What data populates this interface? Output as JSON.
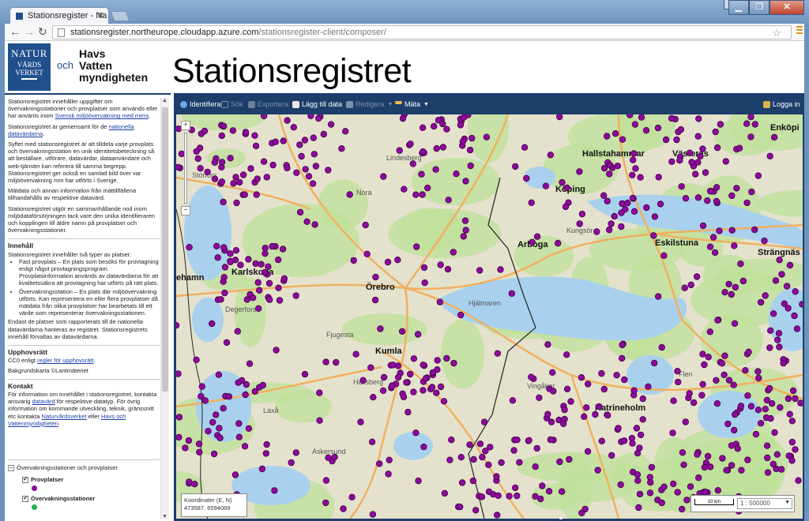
{
  "browser": {
    "tab_title": "Stationsregister - Na",
    "url_host": "stationsregister.northeurope.cloudapp.azure.com",
    "url_path": "/stationsregister-client/composer/"
  },
  "header": {
    "logo_line1": "NATUR",
    "logo_line2": "VÅRDS",
    "logo_line3": "VERKET",
    "och": "och",
    "hav_line1": "Havs",
    "hav_line2": "Vatten",
    "hav_line3": "myndigheten",
    "title": "Stationsregistret"
  },
  "sidebar": {
    "p1": "Stationsregistret innehåller uppgifter om övervakningsstationer och provplatser som används eller har använts inom",
    "p1_link": "Svensk miljöövervakning med mera",
    "p2": "Stationsregistret är gemensamt för de",
    "p2_link": "nationella datavärdarna",
    "p3": "Syftet med stationsregistret är att tilldela varje provplats och övervakningsstation en unik identitetsbeteckning så att beställare, utförare, datavärdar, dataanvändare och web-tjänster kan referera till samma begrepp. Stationsregistret ger också en samlad bild över var miljöövervakning mm har utförts i Sverige.",
    "p4": "Mätdata och annan information från mättillfällena tillhandahålls av respektive datavärd.",
    "p5": "Stationsregistret utgör en sammanhållande nod inom miljödataförsörjningen tack vare den unika identifieraren och kopplingen till äldre namn på provplatser och övervakningsstationer.",
    "h_innehall": "Innehåll",
    "innehall_intro": "Stationsregistret innehåller två typer av platser:",
    "li1": "Fast provplats – En plats som besöks för provtagning enligt något provtagningsprogram. Provplatsinformation används av datavärdarna för att kvalitetssäkra att provtagning har utförts på rätt plats.",
    "li2": "Övervakningsstation – En plats där miljöövervakning utförts. Kan representera en eller flera provplatser då mätdata från olika provplatser har bearbetats till ett värde som representerar övervakningsstationen.",
    "innehall_end": "Endast de platser som rapporterats till de nationella datavärdarna hanteras av registret. Stationsregistrets innehåll förvaltas av datavärdarna.",
    "h_upphov": "Upphovsrätt",
    "upphov_pre": "CC0 enligt",
    "upphov_link": "regler för upphovsrätt",
    "bakgrund": "Bakgrundskarta ©Lantmäteriet",
    "h_kontakt": "Kontakt",
    "kontakt_1": "För information om innehållet i stationsregistret, kontakta ansvarig",
    "kontakt_link1": "datavärd",
    "kontakt_2": "för respektive datatyp. För övrig information om kommande utveckling, teknik, gränssnitt etc kontakta",
    "kontakt_link2": "Naturvårdsverket",
    "kontakt_3": "eller",
    "kontakt_link3": "Havs och Vattenmyndigheten",
    "layer_group": "Övervakningsstationer och provplatser",
    "layer_prov": "Provplatser",
    "layer_overv": "Övervakningsstationer"
  },
  "map_toolbar": {
    "identify": "Identifiera",
    "search": "Sök",
    "export": "Exportera",
    "add_data": "Lägg till data",
    "edit": "Redigera",
    "measure": "Mäta",
    "login": "Logga in"
  },
  "map": {
    "places": [
      "Enköpi",
      "Lindesberg",
      "Hallstahammar",
      "Västerås",
      "Nora",
      "Köping",
      "Kungsör",
      "Arboga",
      "Eskilstuna",
      "Strängnäs",
      "Karlskoga",
      "Örebro",
      "Degerfors",
      "Hjälmaren",
      "Fjugesta",
      "Kumla",
      "Hallsberg",
      "Vingåker",
      "Katrineholm",
      "Flen",
      "Laxå",
      "Askersund",
      "ehamn",
      "Storfors"
    ],
    "coords_label": "Koordinater (E, N)",
    "coords_value": "473587, 6594089",
    "scale_label": "10 km",
    "scale_value": "1 : 500000"
  },
  "colors": {
    "provplats": "#8e0a9c",
    "overvakning": "#22b24c",
    "header_blue": "#1d3d6b"
  }
}
